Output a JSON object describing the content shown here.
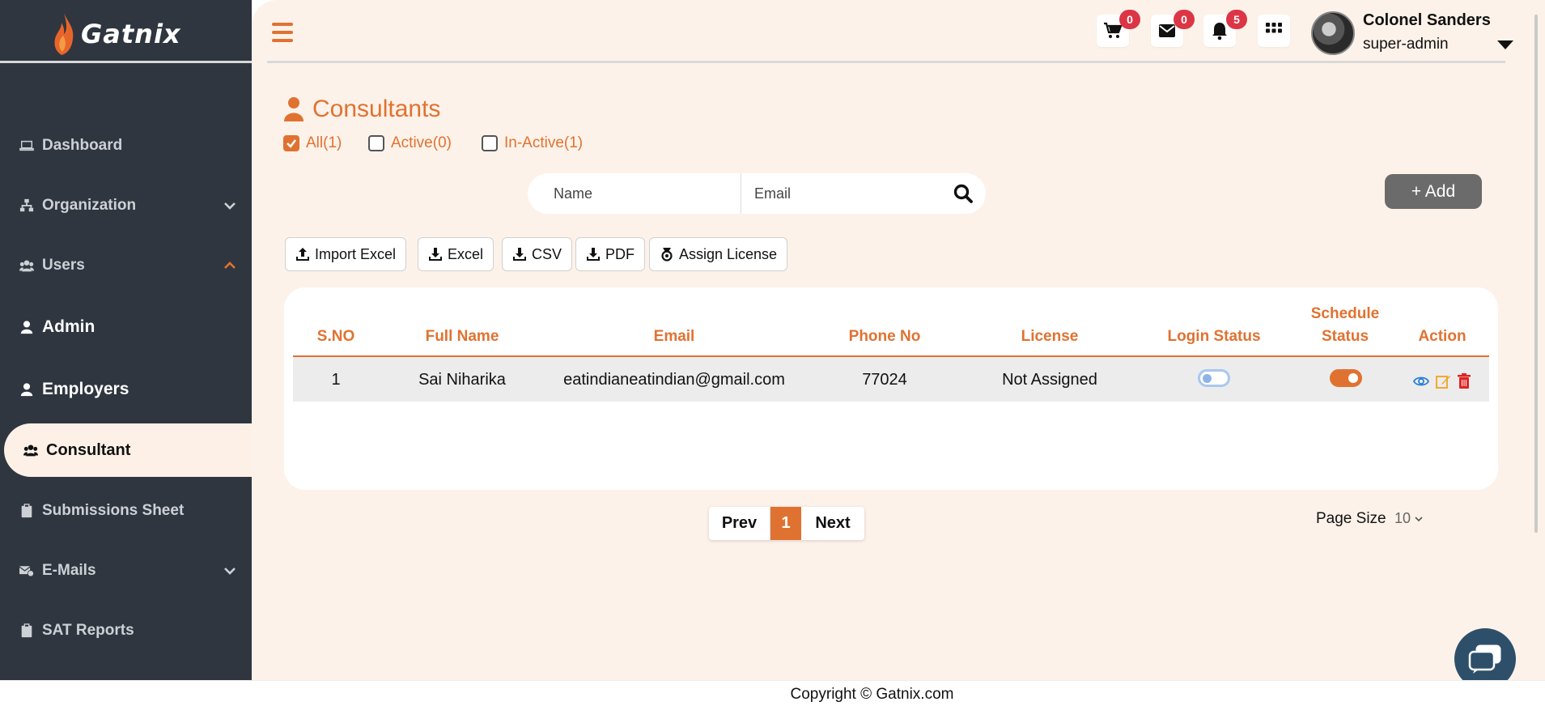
{
  "app": {
    "name": "Gatnix"
  },
  "sidebar": {
    "items": [
      {
        "label": "Dashboard",
        "icon": "laptop-icon"
      },
      {
        "label": "Organization",
        "icon": "sitemap-icon"
      },
      {
        "label": "Users",
        "icon": "users-icon"
      },
      {
        "label": "Admin",
        "icon": "user-icon"
      },
      {
        "label": "Employers",
        "icon": "user-icon"
      },
      {
        "label": "Consultant",
        "icon": "users-icon",
        "active": true
      },
      {
        "label": "Submissions Sheet",
        "icon": "clipboard-icon"
      },
      {
        "label": "E-Mails",
        "icon": "mail-check-icon"
      },
      {
        "label": "SAT Reports",
        "icon": "clipboard-icon"
      }
    ]
  },
  "header": {
    "cart_count": "0",
    "mail_count": "0",
    "notification_count": "5",
    "user_name": "Colonel Sanders",
    "user_role": "super-admin"
  },
  "page": {
    "title": "Consultants",
    "filters": [
      {
        "label": "All(1)",
        "checked": true
      },
      {
        "label": "Active(0)",
        "checked": false
      },
      {
        "label": "In-Active(1)",
        "checked": false
      }
    ],
    "search": {
      "name_placeholder": "Name",
      "email_placeholder": "Email"
    },
    "add_label": "+ Add",
    "toolbar": {
      "import_excel": "Import Excel",
      "excel": "Excel",
      "csv": "CSV",
      "pdf": "PDF",
      "assign_license": "Assign License"
    }
  },
  "table": {
    "headers": {
      "sno": "S.NO",
      "full_name": "Full Name",
      "email": "Email",
      "phone": "Phone No",
      "license": "License",
      "login_status": "Login Status",
      "schedule_status_1": "Schedule",
      "schedule_status_2": "Status",
      "action": "Action"
    },
    "rows": [
      {
        "sno": "1",
        "full_name": "Sai Niharika",
        "email": "eatindianeatindian@gmail.com",
        "phone": "77024",
        "license": "Not Assigned",
        "login_status": false,
        "schedule_status": true
      }
    ]
  },
  "pagination": {
    "prev": "Prev",
    "current": "1",
    "next": "Next",
    "page_size_label": "Page Size",
    "page_size": "10"
  },
  "footer": {
    "text": "Copyright © Gatnix.com"
  },
  "colors": {
    "accent": "#e07231",
    "sidebar": "#2f3640",
    "background": "#fdf2e9"
  }
}
